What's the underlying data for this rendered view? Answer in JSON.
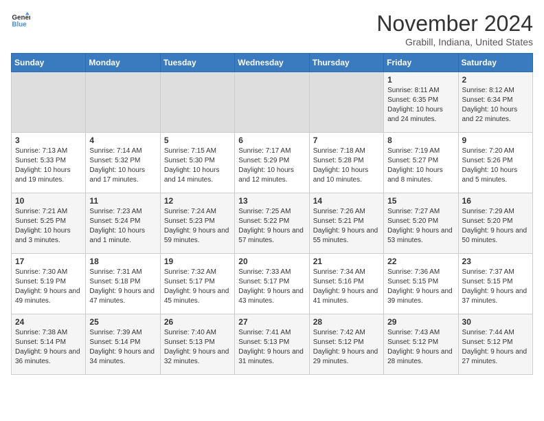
{
  "logo": {
    "line1": "General",
    "line2": "Blue"
  },
  "calendar": {
    "title": "November 2024",
    "subtitle": "Grabill, Indiana, United States"
  },
  "weekdays": [
    "Sunday",
    "Monday",
    "Tuesday",
    "Wednesday",
    "Thursday",
    "Friday",
    "Saturday"
  ],
  "weeks": [
    [
      {
        "day": "",
        "empty": true
      },
      {
        "day": "",
        "empty": true
      },
      {
        "day": "",
        "empty": true
      },
      {
        "day": "",
        "empty": true
      },
      {
        "day": "",
        "empty": true
      },
      {
        "day": "1",
        "sunrise": "Sunrise: 8:11 AM",
        "sunset": "Sunset: 6:35 PM",
        "daylight": "Daylight: 10 hours and 24 minutes."
      },
      {
        "day": "2",
        "sunrise": "Sunrise: 8:12 AM",
        "sunset": "Sunset: 6:34 PM",
        "daylight": "Daylight: 10 hours and 22 minutes."
      }
    ],
    [
      {
        "day": "3",
        "sunrise": "Sunrise: 7:13 AM",
        "sunset": "Sunset: 5:33 PM",
        "daylight": "Daylight: 10 hours and 19 minutes."
      },
      {
        "day": "4",
        "sunrise": "Sunrise: 7:14 AM",
        "sunset": "Sunset: 5:32 PM",
        "daylight": "Daylight: 10 hours and 17 minutes."
      },
      {
        "day": "5",
        "sunrise": "Sunrise: 7:15 AM",
        "sunset": "Sunset: 5:30 PM",
        "daylight": "Daylight: 10 hours and 14 minutes."
      },
      {
        "day": "6",
        "sunrise": "Sunrise: 7:17 AM",
        "sunset": "Sunset: 5:29 PM",
        "daylight": "Daylight: 10 hours and 12 minutes."
      },
      {
        "day": "7",
        "sunrise": "Sunrise: 7:18 AM",
        "sunset": "Sunset: 5:28 PM",
        "daylight": "Daylight: 10 hours and 10 minutes."
      },
      {
        "day": "8",
        "sunrise": "Sunrise: 7:19 AM",
        "sunset": "Sunset: 5:27 PM",
        "daylight": "Daylight: 10 hours and 8 minutes."
      },
      {
        "day": "9",
        "sunrise": "Sunrise: 7:20 AM",
        "sunset": "Sunset: 5:26 PM",
        "daylight": "Daylight: 10 hours and 5 minutes."
      }
    ],
    [
      {
        "day": "10",
        "sunrise": "Sunrise: 7:21 AM",
        "sunset": "Sunset: 5:25 PM",
        "daylight": "Daylight: 10 hours and 3 minutes."
      },
      {
        "day": "11",
        "sunrise": "Sunrise: 7:23 AM",
        "sunset": "Sunset: 5:24 PM",
        "daylight": "Daylight: 10 hours and 1 minute."
      },
      {
        "day": "12",
        "sunrise": "Sunrise: 7:24 AM",
        "sunset": "Sunset: 5:23 PM",
        "daylight": "Daylight: 9 hours and 59 minutes."
      },
      {
        "day": "13",
        "sunrise": "Sunrise: 7:25 AM",
        "sunset": "Sunset: 5:22 PM",
        "daylight": "Daylight: 9 hours and 57 minutes."
      },
      {
        "day": "14",
        "sunrise": "Sunrise: 7:26 AM",
        "sunset": "Sunset: 5:21 PM",
        "daylight": "Daylight: 9 hours and 55 minutes."
      },
      {
        "day": "15",
        "sunrise": "Sunrise: 7:27 AM",
        "sunset": "Sunset: 5:20 PM",
        "daylight": "Daylight: 9 hours and 53 minutes."
      },
      {
        "day": "16",
        "sunrise": "Sunrise: 7:29 AM",
        "sunset": "Sunset: 5:20 PM",
        "daylight": "Daylight: 9 hours and 50 minutes."
      }
    ],
    [
      {
        "day": "17",
        "sunrise": "Sunrise: 7:30 AM",
        "sunset": "Sunset: 5:19 PM",
        "daylight": "Daylight: 9 hours and 49 minutes."
      },
      {
        "day": "18",
        "sunrise": "Sunrise: 7:31 AM",
        "sunset": "Sunset: 5:18 PM",
        "daylight": "Daylight: 9 hours and 47 minutes."
      },
      {
        "day": "19",
        "sunrise": "Sunrise: 7:32 AM",
        "sunset": "Sunset: 5:17 PM",
        "daylight": "Daylight: 9 hours and 45 minutes."
      },
      {
        "day": "20",
        "sunrise": "Sunrise: 7:33 AM",
        "sunset": "Sunset: 5:17 PM",
        "daylight": "Daylight: 9 hours and 43 minutes."
      },
      {
        "day": "21",
        "sunrise": "Sunrise: 7:34 AM",
        "sunset": "Sunset: 5:16 PM",
        "daylight": "Daylight: 9 hours and 41 minutes."
      },
      {
        "day": "22",
        "sunrise": "Sunrise: 7:36 AM",
        "sunset": "Sunset: 5:15 PM",
        "daylight": "Daylight: 9 hours and 39 minutes."
      },
      {
        "day": "23",
        "sunrise": "Sunrise: 7:37 AM",
        "sunset": "Sunset: 5:15 PM",
        "daylight": "Daylight: 9 hours and 37 minutes."
      }
    ],
    [
      {
        "day": "24",
        "sunrise": "Sunrise: 7:38 AM",
        "sunset": "Sunset: 5:14 PM",
        "daylight": "Daylight: 9 hours and 36 minutes."
      },
      {
        "day": "25",
        "sunrise": "Sunrise: 7:39 AM",
        "sunset": "Sunset: 5:14 PM",
        "daylight": "Daylight: 9 hours and 34 minutes."
      },
      {
        "day": "26",
        "sunrise": "Sunrise: 7:40 AM",
        "sunset": "Sunset: 5:13 PM",
        "daylight": "Daylight: 9 hours and 32 minutes."
      },
      {
        "day": "27",
        "sunrise": "Sunrise: 7:41 AM",
        "sunset": "Sunset: 5:13 PM",
        "daylight": "Daylight: 9 hours and 31 minutes."
      },
      {
        "day": "28",
        "sunrise": "Sunrise: 7:42 AM",
        "sunset": "Sunset: 5:12 PM",
        "daylight": "Daylight: 9 hours and 29 minutes."
      },
      {
        "day": "29",
        "sunrise": "Sunrise: 7:43 AM",
        "sunset": "Sunset: 5:12 PM",
        "daylight": "Daylight: 9 hours and 28 minutes."
      },
      {
        "day": "30",
        "sunrise": "Sunrise: 7:44 AM",
        "sunset": "Sunset: 5:12 PM",
        "daylight": "Daylight: 9 hours and 27 minutes."
      }
    ]
  ]
}
